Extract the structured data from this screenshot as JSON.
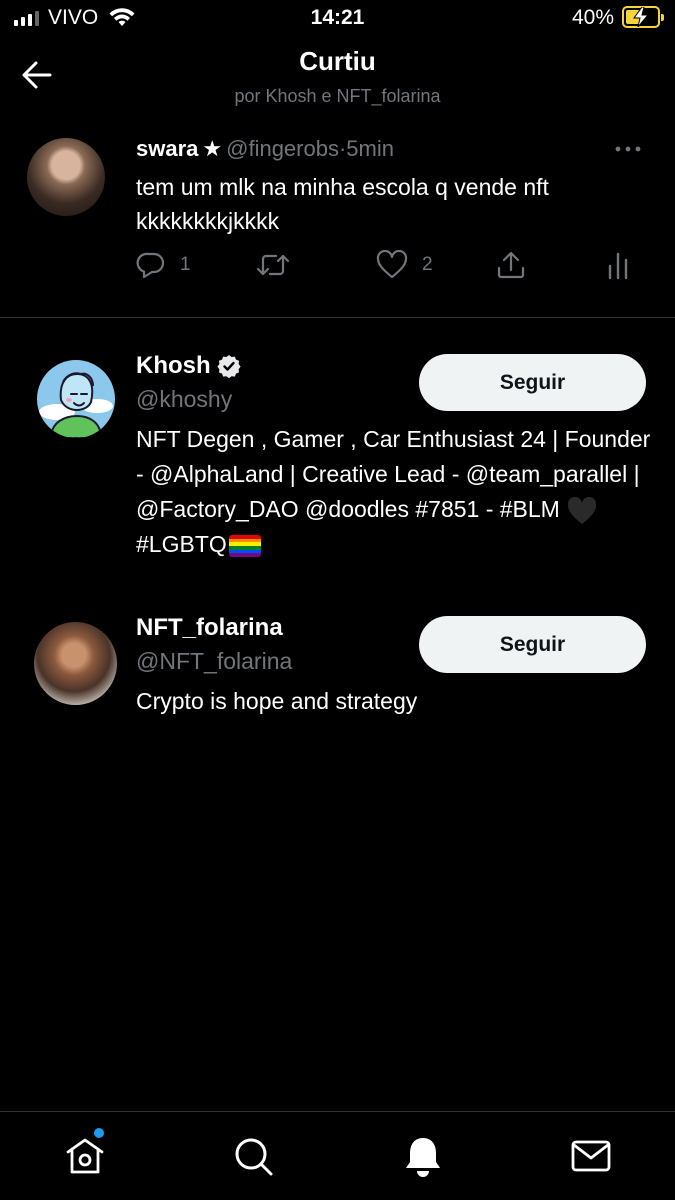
{
  "status_bar": {
    "carrier": "VIVO",
    "time": "14:21",
    "battery_percent": "40%"
  },
  "header": {
    "title": "Curtiu",
    "subtitle": "por Khosh e NFT_folarina",
    "back_icon": "arrow-left-icon"
  },
  "tweet": {
    "name": "swara",
    "name_suffix": "★",
    "handle": "@fingerobs",
    "separator": "·",
    "time": "5min",
    "text": "tem um mlk na minha escola q vende nft kkkkkkkkjkkkk",
    "replies": "1",
    "retweets": "",
    "likes": "2"
  },
  "users": [
    {
      "name": "Khosh",
      "verified": true,
      "handle": "@khoshy",
      "bio": "NFT Degen , Gamer , Car Enthusiast 24 | Founder - @AlphaLand | Creative Lead - @team_parallel | @Factory_DAO @doodles #7851 - #BLM",
      "bio_tail": "#LGBTQ",
      "follow_label": "Seguir"
    },
    {
      "name": "NFT_folarina",
      "verified": false,
      "handle": "@NFT_folarina",
      "bio": "Crypto is hope and strategy",
      "follow_label": "Seguir"
    }
  ],
  "nav": {
    "items": [
      "home-icon",
      "search-icon",
      "notifications-icon",
      "messages-icon"
    ],
    "accent": "#1d9bf0"
  }
}
